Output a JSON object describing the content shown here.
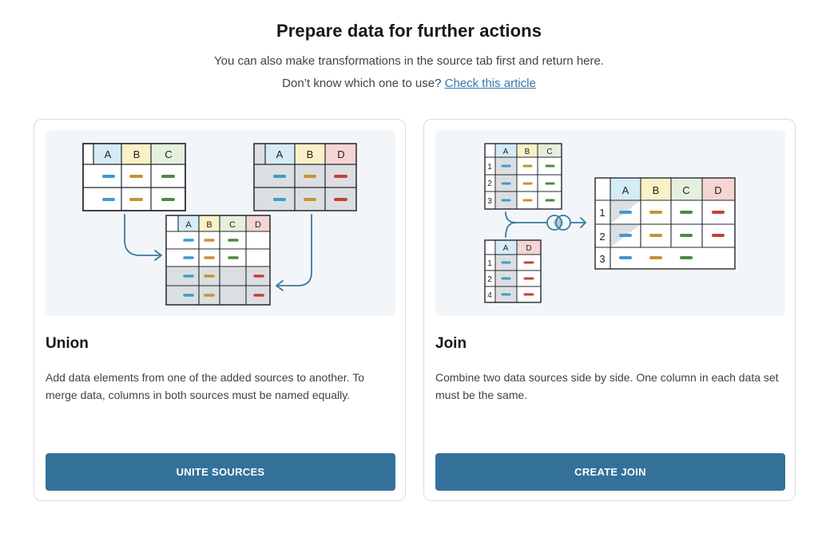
{
  "header": {
    "title": "Prepare data for further actions",
    "subtitle": "You can also make transformations in the source tab first and return here.",
    "help_prefix": "Don’t know which one to use? ",
    "help_link": "Check this article"
  },
  "cards": [
    {
      "id": "union",
      "title": "Union",
      "description": "Add data elements from one of the added sources to another. To merge data, columns in both sources must be named equally.",
      "button": "UNITE SOURCES"
    },
    {
      "id": "join",
      "title": "Join",
      "description": "Combine two data sources side by side. One column in each data set must be the same.",
      "button": "CREATE JOIN"
    }
  ],
  "illustrations": {
    "column_letters": [
      "A",
      "B",
      "C",
      "D"
    ],
    "join_row_numbers_top": [
      "1",
      "2",
      "3"
    ],
    "join_row_numbers_bottom": [
      "1",
      "2",
      "4"
    ],
    "join_row_numbers_result": [
      "1",
      "2",
      "3"
    ]
  },
  "colors": {
    "col_a": "#d5ecf6",
    "col_b": "#fbf1c6",
    "col_c": "#e4f0dc",
    "col_d": "#f5d5d3",
    "dash_a": "#3e9bd0",
    "dash_b": "#c89235",
    "dash_c": "#4c8a45",
    "dash_d": "#c84034",
    "accent": "#34719a",
    "line": "#3a7aa0"
  }
}
